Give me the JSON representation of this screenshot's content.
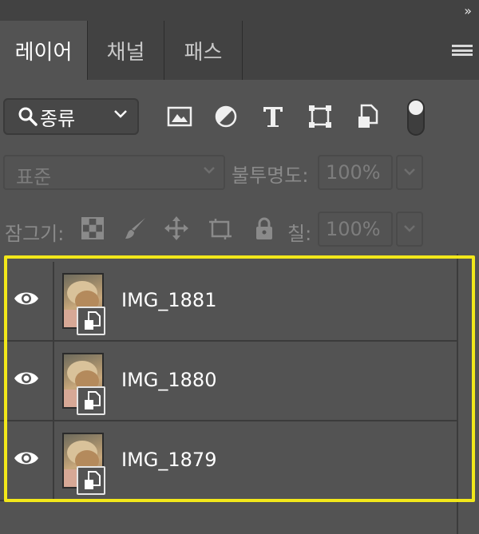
{
  "panel": {
    "collapse_glyph": "››",
    "tabs": [
      {
        "label": "레이어",
        "active": true
      },
      {
        "label": "채널",
        "active": false
      },
      {
        "label": "패스",
        "active": false
      }
    ]
  },
  "filter": {
    "kind_label": "종류",
    "icons": [
      "image-filter-icon",
      "adjustment-filter-icon",
      "type-filter-icon",
      "shape-filter-icon",
      "smart-object-filter-icon",
      "filter-toggle"
    ]
  },
  "blend": {
    "mode": "표준",
    "opacity_label": "불투명도:",
    "opacity_value": "100%"
  },
  "lock": {
    "label": "잠그기:",
    "fill_label": "칠:",
    "fill_value": "100%",
    "icons": [
      "lock-transparent-pixels-icon",
      "lock-image-pixels-icon",
      "lock-position-icon",
      "lock-artboard-icon",
      "lock-all-icon"
    ]
  },
  "layers": [
    {
      "name": "IMG_1881",
      "visible": true
    },
    {
      "name": "IMG_1880",
      "visible": true
    },
    {
      "name": "IMG_1879",
      "visible": true
    }
  ],
  "colors": {
    "panel_bg": "#535353",
    "tab_bar_bg": "#424242",
    "highlight": "#f2e71a"
  }
}
